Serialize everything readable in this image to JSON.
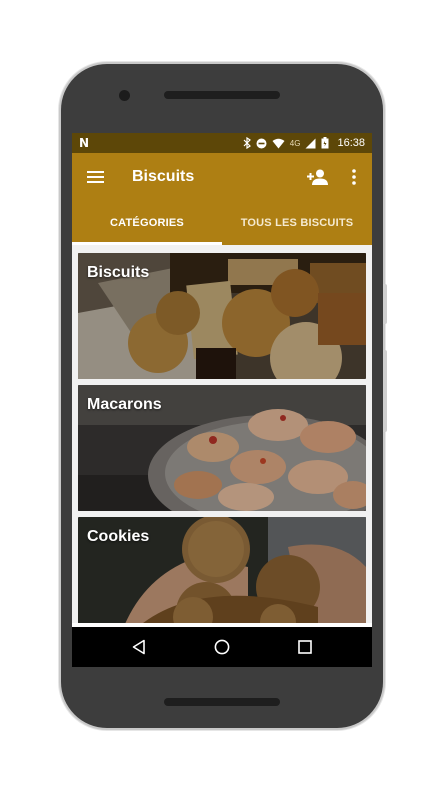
{
  "status_bar": {
    "network_label": "4G",
    "time": "16:38"
  },
  "app_bar": {
    "title": "Biscuits",
    "icons": [
      "menu-icon",
      "add-person-icon",
      "more-vert-icon"
    ]
  },
  "tabs": [
    {
      "label": "CATÉGORIES",
      "selected": true
    },
    {
      "label": "TOUS LES BISCUITS",
      "selected": false
    }
  ],
  "categories": [
    {
      "label": "Biscuits"
    },
    {
      "label": "Macarons"
    },
    {
      "label": "Cookies"
    }
  ],
  "nav_bar": {
    "icons": [
      "back-icon",
      "home-icon",
      "recents-icon"
    ]
  },
  "colors": {
    "primary": "#ae7f13",
    "status_bar": "#5d4708",
    "background": "#f1f1f1"
  }
}
